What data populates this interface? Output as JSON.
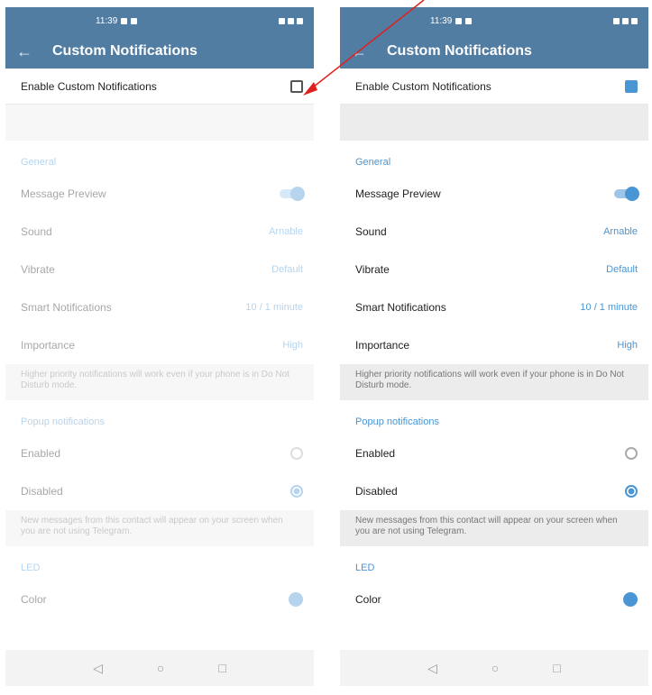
{
  "status_time": "11:39",
  "title": "Custom Notifications",
  "enable_label": "Enable Custom Notifications",
  "general_header": "General",
  "message_preview": "Message Preview",
  "sound_label": "Sound",
  "sound_value": "Arnable",
  "vibrate_label": "Vibrate",
  "vibrate_value": "Default",
  "smart_label": "Smart Notifications",
  "smart_value": "10 / 1 minute",
  "importance_label": "Importance",
  "importance_value": "High",
  "importance_info": "Higher priority notifications will work even if your phone is in Do Not Disturb mode.",
  "popup_header": "Popup notifications",
  "popup_enabled": "Enabled",
  "popup_disabled": "Disabled",
  "popup_info": "New messages from this contact will appear on your screen when you are not using Telegram.",
  "led_header": "LED",
  "color_label": "Color",
  "left_enabled": false,
  "right_enabled": true,
  "accent_color": "#4a95d4",
  "header_color": "#527da3",
  "annotation_color": "#e0201d"
}
